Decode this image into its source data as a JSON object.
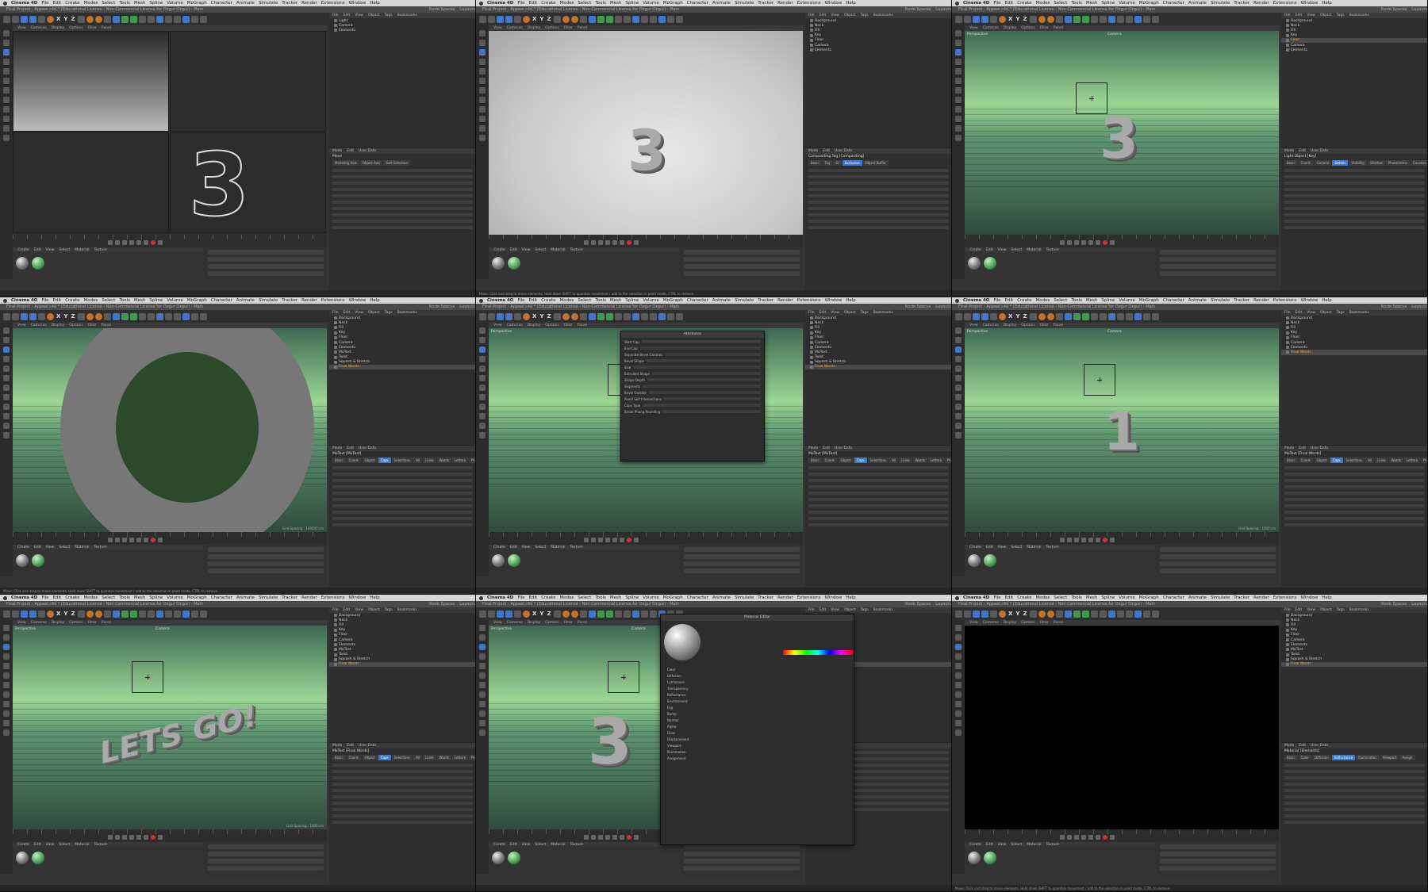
{
  "menubar": {
    "app": "Cinema 4D",
    "items": [
      "File",
      "Edit",
      "Create",
      "Modes",
      "Select",
      "Tools",
      "Mesh",
      "Spline",
      "Volume",
      "MoGraph",
      "Character",
      "Animate",
      "Simulate",
      "Tracker",
      "Render",
      "Extensions",
      "Window",
      "Help"
    ]
  },
  "titlebar": {
    "title": "Final Project - Appeal.c4d * (Educational License - Non-Commercial License for Ozgur Ozgur) - Main",
    "node_spaces": "Node Spaces",
    "layouts": "Layouts"
  },
  "toolbar": {
    "axis_x": "X",
    "axis_y": "Y",
    "axis_z": "Z"
  },
  "viewport_menu": [
    "View",
    "Cameras",
    "Display",
    "Options",
    "Filter",
    "Panel"
  ],
  "panel_menu": [
    "File",
    "Edit",
    "View",
    "Object",
    "Tags",
    "Bookmarks"
  ],
  "attr_menu": [
    "Mode",
    "Edit",
    "User Data"
  ],
  "mat_menu": [
    "Create",
    "Edit",
    "View",
    "Select",
    "Material",
    "Texture"
  ],
  "panels": [
    {
      "id": "p1",
      "view": "Perspective",
      "camera": "Default Camera",
      "grid": "Grid Spacing : 100 cm",
      "objects": [
        "Light",
        "Camera",
        "Elements"
      ],
      "attr_title": "Move",
      "attr_tabs": [
        "Modeling Axis",
        "Object Axis",
        "Soft Selection"
      ],
      "status": ""
    },
    {
      "id": "p2",
      "view": "",
      "camera": "",
      "grid": "",
      "number": "3",
      "objects": [
        "Background",
        "Neck",
        "Fill",
        "Key",
        "Floor",
        "Camera",
        "Elements"
      ],
      "attr_title": "Compositing Tag [Compositing]",
      "attr_tabs": [
        "Basic",
        "Tag",
        "GI",
        "Exclusion",
        "Object Buffer"
      ],
      "status": "Move: Click and drag to move elements. Hold down SHIFT to quantize movement / add to the selection in point mode, CTRL to remove."
    },
    {
      "id": "p3",
      "view": "Perspective",
      "camera": "Camera",
      "grid": "",
      "number": "3",
      "objects": [
        "Background",
        "Neck",
        "Fill",
        "Key",
        "Floor",
        "Camera",
        "Elements"
      ],
      "attr_title": "Light Object [Key]",
      "attr_tabs": [
        "Basic",
        "Coord.",
        "General",
        "Details",
        "Visibility",
        "Shadow",
        "Photometric",
        "Caustics",
        "Noise",
        "Lens",
        "Project"
      ],
      "status": ""
    },
    {
      "id": "p4",
      "view": "",
      "camera": "Default Camera",
      "grid": "Grid Spacing : 100000 cm",
      "objects": [
        "Background",
        "Neck",
        "Fill",
        "Key",
        "Floor",
        "Camera",
        "Elements",
        "MoText",
        "Twist",
        "Squash & Stretch",
        "Final Words"
      ],
      "attr_title": "MoText [MoText]",
      "attr_tabs": [
        "Basic",
        "Coord.",
        "Object",
        "Caps",
        "Selections",
        "All",
        "Lines",
        "Words",
        "Letters",
        "Phong"
      ],
      "status": "Move: Click and drag to move elements. Hold down SHIFT to quantize movement / add to the selection in point mode, CTRL to remove."
    },
    {
      "id": "p5",
      "view": "Perspective",
      "camera": "",
      "grid": "",
      "popup_title": "Attributes",
      "popup_props": [
        "Start Cap",
        "End Cap",
        "Separate Bevel Controls",
        "Bevel Shape",
        "Size",
        "Extruded Shape",
        "Shape Depth",
        "Segments",
        "Bevel Outside",
        "Avoid Self Intersections",
        "Caps Type",
        "Break Phong Rounding"
      ],
      "objects": [
        "Background",
        "Neck",
        "Fill",
        "Key",
        "Floor",
        "Camera",
        "Elements",
        "MoText",
        "Twist",
        "Squash & Stretch",
        "Final Words"
      ],
      "attr_title": "MoText [MoText]",
      "attr_tabs": [
        "Basic",
        "Coord.",
        "Object",
        "Caps",
        "Selections",
        "All",
        "Lines",
        "Words",
        "Letters",
        "Phong"
      ],
      "status": ""
    },
    {
      "id": "p6",
      "view": "Perspective",
      "camera": "Camera",
      "grid": "Grid Spacing : 1000 cm",
      "number": "1",
      "objects": [
        "Background",
        "Neck",
        "Fill",
        "Key",
        "Floor",
        "Camera",
        "Elements",
        "Final Words"
      ],
      "attr_title": "MoText [Final Words]",
      "attr_tabs": [
        "Basic",
        "Coord.",
        "Object",
        "Caps",
        "Selections",
        "All",
        "Lines",
        "Words",
        "Letters",
        "Phong"
      ],
      "status": ""
    },
    {
      "id": "p7",
      "view": "Perspective",
      "camera": "Camera",
      "grid": "Grid Spacing : 1000 cm",
      "number": "LETS GO!",
      "objects": [
        "Background",
        "Neck",
        "Fill",
        "Key",
        "Floor",
        "Camera",
        "Elements",
        "MoText",
        "Twist",
        "Squash & Stretch",
        "Final Words"
      ],
      "attr_title": "MoText [Final Words]",
      "attr_tabs": [
        "Basic",
        "Coord.",
        "Object",
        "Caps",
        "Selections",
        "All",
        "Lines",
        "Words",
        "Letters",
        "Phong"
      ],
      "status": ""
    },
    {
      "id": "p8",
      "view": "Perspective",
      "camera": "Camera",
      "grid": "",
      "number": "3",
      "popup_title": "Material Editor",
      "popup_props": [
        "Color",
        "Diffusion",
        "Luminance",
        "Transparency",
        "Reflectance",
        "Environment",
        "Fog",
        "Bump",
        "Normal",
        "Alpha",
        "Glow",
        "Displacement",
        "Viewport",
        "Illumination",
        "Assignment"
      ],
      "objects": [
        "Background",
        "Neck",
        "Fill",
        "Key",
        "Floor",
        "Camera",
        "Elements",
        "MoText",
        "Twist",
        "Squash & Stretch",
        "Final Words"
      ],
      "attr_title": "",
      "attr_tabs": [],
      "status": ""
    },
    {
      "id": "p9",
      "view": "",
      "camera": "",
      "grid": "",
      "objects": [
        "Background",
        "Neck",
        "Fill",
        "Key",
        "Floor",
        "Camera",
        "Elements",
        "MoText",
        "Twist",
        "Squash & Stretch",
        "Final Words"
      ],
      "attr_title": "Material [Elements]",
      "attr_tabs": [
        "Basic",
        "Color",
        "Diffusion",
        "Reflectance",
        "Illumination",
        "Viewport",
        "Assign"
      ],
      "status": "Move: Click and drag to move elements. Hold down SHIFT to quantize movement / add to the selection in point mode, CTRL to remove."
    }
  ]
}
